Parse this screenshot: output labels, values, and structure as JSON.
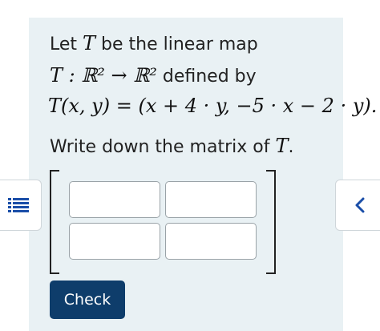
{
  "problem": {
    "line1_prefix": "Let ",
    "line1_T": "T",
    "line1_suffix": " be the linear map",
    "line2_math": "T : ℝ² → ℝ²",
    "line2_suffix": " defined by",
    "line3_math": "T(x, y) = (x + 4 · y, −5 · x − 2 · y).",
    "line4_prefix": "Write down the matrix of ",
    "line4_T": "T",
    "line4_suffix": "."
  },
  "matrix": {
    "cells": [
      [
        "",
        ""
      ],
      [
        "",
        ""
      ]
    ]
  },
  "actions": {
    "check_label": "Check"
  },
  "icons": {
    "left": "list-icon",
    "right": "chevron-left-icon"
  },
  "colors": {
    "card_background": "#e9f1f4",
    "button_background": "#0e3d6b",
    "icon_blue": "#1a4ea8"
  }
}
